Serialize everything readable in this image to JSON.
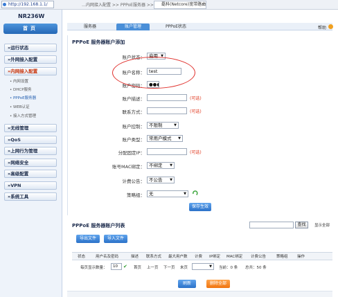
{
  "browser": {
    "url": "http://192.168.1.1/",
    "breadcrumb": "…内网接入配置 >> PPPoE服务器 >> 账户配置",
    "tab_title": "磊科(Netcore)宽带路由器…",
    "tab_close": "×"
  },
  "sidebar": {
    "model": "NR236W",
    "home_label": "首页",
    "items": [
      {
        "label": "»运行状态"
      },
      {
        "label": "»外网接入配置"
      },
      {
        "label": "»内网接入配置"
      },
      {
        "label": "»无线管理"
      },
      {
        "label": "»QoS"
      },
      {
        "label": "»上网行为管理"
      },
      {
        "label": "»网络安全"
      },
      {
        "label": "»高级配置"
      },
      {
        "label": "»VPN"
      },
      {
        "label": "»系统工具"
      }
    ],
    "subitems": [
      {
        "label": "• 内网设置"
      },
      {
        "label": "• DHCP服务"
      },
      {
        "label": "• PPPoE服务器"
      },
      {
        "label": "• WEB认证"
      },
      {
        "label": "• 接入方式管理"
      }
    ]
  },
  "tabs": {
    "items": [
      "服务器",
      "账户管理",
      "PPPoE状态"
    ],
    "help": "帮助"
  },
  "add_form": {
    "title": "PPPoE 服务器账户添加",
    "account_status": {
      "label": "账户状态：",
      "value": "启用"
    },
    "account_name": {
      "label": "账户名称：",
      "value": "test"
    },
    "account_password": {
      "label": "账户密码：",
      "value": "●●●●"
    },
    "account_desc": {
      "label": "账户描述：",
      "value": "",
      "hint": "(可选)"
    },
    "contact": {
      "label": "联系方式：",
      "value": "",
      "hint": "(可选)"
    },
    "account_control": {
      "label": "账户控制：",
      "value": "不限制"
    },
    "account_type": {
      "label": "账户类型：",
      "value": "常用户模式"
    },
    "assign_ip": {
      "label": "分配固定IP：",
      "value": "",
      "hint": "(可选)"
    },
    "mac_bind": {
      "label": "账号MAC绑定：",
      "value": "不绑定"
    },
    "billing_notice": {
      "label": "计费公告：",
      "value": "不公告"
    },
    "policy_group": {
      "label": "策略组：",
      "value": "无"
    },
    "save_button": "保存生效"
  },
  "list": {
    "title": "PPPoE 服务器账户列表",
    "search_button": "查找",
    "show_all": "显示全部",
    "export_button": "导出文件",
    "import_button": "导入文件",
    "columns": [
      "状态",
      "用户名及密码",
      "描述",
      "联系方式",
      "最大用户数",
      "计费",
      "IP绑定",
      "MAC绑定",
      "计费公告",
      "策略组",
      "操作"
    ],
    "pager": {
      "per_page_label": "每页显示数量：",
      "per_page_value": "10",
      "first": "首页",
      "prev": "上一页",
      "next": "下一页",
      "last": "末页",
      "current_label": "当前：0 条",
      "total_label": "总共：50 条"
    },
    "refresh_button": "刷新",
    "delete_button": "删除全部"
  }
}
